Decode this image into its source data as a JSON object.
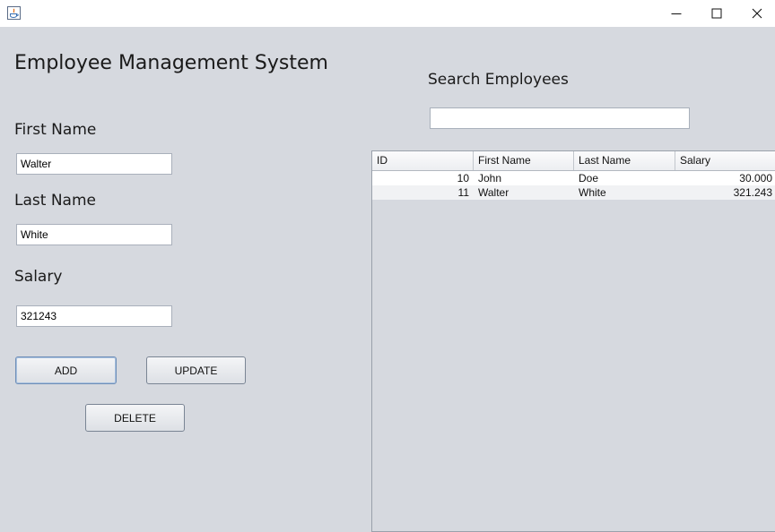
{
  "window": {
    "icon": "java-icon",
    "controls": [
      "minimize-icon",
      "maximize-icon",
      "close-icon"
    ]
  },
  "form": {
    "title": "Employee Management System",
    "first_name_label": "First Name",
    "first_name_value": "Walter",
    "last_name_label": "Last Name",
    "last_name_value": "White",
    "salary_label": "Salary",
    "salary_value": "321243",
    "add_label": "ADD",
    "update_label": "UPDATE",
    "delete_label": "DELETE"
  },
  "search": {
    "label": "Search Employees",
    "value": ""
  },
  "table": {
    "columns": [
      "ID",
      "First Name",
      "Last Name",
      "Salary"
    ],
    "rows": [
      [
        "10",
        "John",
        "Doe",
        "30.000"
      ],
      [
        "11",
        "Walter",
        "White",
        "321.243"
      ]
    ]
  }
}
